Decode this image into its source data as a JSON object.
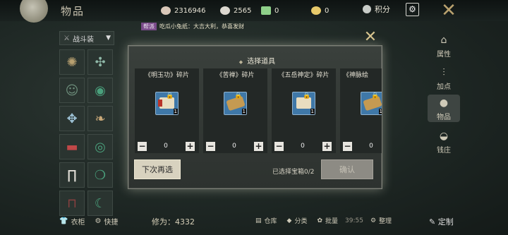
{
  "header": {
    "title": "物品",
    "currencies": [
      {
        "name": "silver-coin-icon",
        "value": "2316946",
        "color": "#d9c7b8"
      },
      {
        "name": "ingot-icon",
        "value": "2565",
        "color": "#dcd8d0"
      },
      {
        "name": "ticket-icon",
        "value": "0",
        "color": "#8fd18a"
      },
      {
        "name": "gold-ingot-icon",
        "value": "0",
        "color": "#e7c96a"
      }
    ],
    "points_label": "积分",
    "settings_icon": "settings-icon"
  },
  "chat": {
    "channel": "帮派",
    "message": "吃瓜小兔纸：大吉大利，恭喜发财"
  },
  "left_panel": {
    "equip_label": "战斗装",
    "wardrobe_label": "衣柜",
    "shortcut_label": "快捷",
    "stat_label": "修为：4332"
  },
  "right_nav": {
    "items": [
      {
        "label": "属性",
        "icon": "attributes-icon"
      },
      {
        "label": "加点",
        "icon": "sliders-icon"
      },
      {
        "label": "物品",
        "icon": "bag-icon"
      },
      {
        "label": "钱庄",
        "icon": "money-pouch-icon"
      }
    ],
    "custom_label": "定制"
  },
  "bottom_bar": {
    "warehouse": "仓库",
    "classify": "分类",
    "batch": "批量",
    "time": "39:55",
    "arrange": "整理"
  },
  "dialog": {
    "title": "选择道具",
    "items": [
      {
        "name": "《明玉功》碎片",
        "type": "book",
        "count": "1",
        "quantity": "0"
      },
      {
        "name": "《苦禅》碎片",
        "type": "scroll",
        "count": "1",
        "quantity": "0"
      },
      {
        "name": "《五岳神定》碎片",
        "type": "book",
        "count": "1",
        "quantity": "0"
      },
      {
        "name": "《神脉绘",
        "type": "scroll",
        "count": "1",
        "quantity": "0"
      }
    ],
    "next_time_label": "下次再选",
    "selected_info": "已选择宝箱0/2",
    "confirm_label": "确认"
  }
}
